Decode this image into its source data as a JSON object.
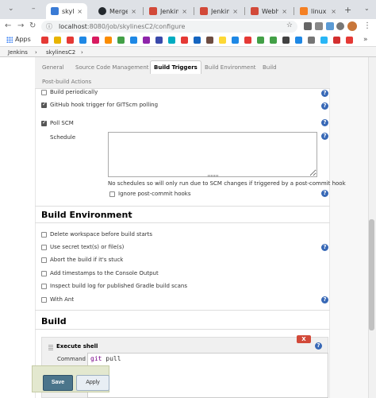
{
  "browser": {
    "tabs": [
      {
        "label": "skylinesC",
        "color": "#3a7bd5",
        "active": true
      },
      {
        "label": "Merge",
        "color": "#24292e"
      },
      {
        "label": "Jenkins",
        "color": "#d24939"
      },
      {
        "label": "Jenkins",
        "color": "#d24939"
      },
      {
        "label": "Webho",
        "color": "#d24939"
      },
      {
        "label": "linux - s",
        "color": "#f48024"
      }
    ],
    "url_host": "localhost",
    "url_path": ":8080/job/skylinesC2/configure",
    "apps_label": "Apps"
  },
  "breadcrumb": {
    "root": "Jenkins",
    "sep": "›",
    "job": "skylinesC2",
    "sep2": "›"
  },
  "config_tabs": {
    "general": "General",
    "scm": "Source Code Management",
    "triggers": "Build Triggers",
    "environment": "Build Environment",
    "build": "Build",
    "post": "Post-build Actions"
  },
  "triggers": {
    "periodically": "Build periodically",
    "github_hook": "GitHub hook trigger for GITScm polling",
    "poll_scm": "Poll SCM",
    "schedule_label": "Schedule",
    "schedule_value": "",
    "schedule_msg": "No schedules so will only run due to SCM changes if triggered by a post-commit hook",
    "ignore_post_commit": "Ignore post-commit hooks"
  },
  "build_environment": {
    "title": "Build Environment",
    "options": [
      "Delete workspace before build starts",
      "Use secret text(s) or file(s)",
      "Abort the build if it's stuck",
      "Add timestamps to the Console Output",
      "Inspect build log for published Gradle build scans",
      "With Ant"
    ]
  },
  "build": {
    "title": "Build",
    "step_title": "Execute shell",
    "delete_label": "X",
    "command_label": "Command",
    "command_kw": "git",
    "command_rest": " pull"
  },
  "actions": {
    "save": "Save",
    "apply": "Apply"
  },
  "help_label": "?"
}
